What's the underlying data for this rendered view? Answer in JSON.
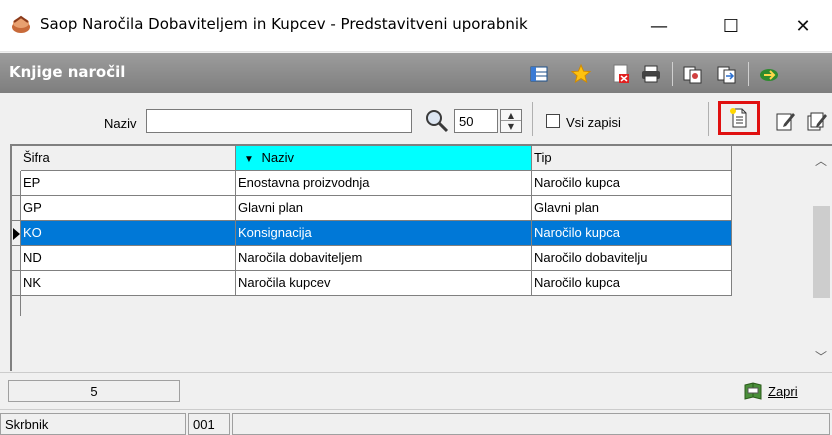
{
  "window": {
    "title": "Saop Naročila Dobaviteljem in Kupcev - Predstavitveni uporabnik",
    "minimize": "—",
    "maximize": "☐",
    "close": "✕"
  },
  "header": {
    "title": "Knjige naročil"
  },
  "toolbar": {
    "naziv_label": "Naziv",
    "naziv_value": "",
    "count_value": "50",
    "vsi_zapisi_label": "Vsi zapisi",
    "vsi_zapisi_checked": false
  },
  "grid": {
    "columns": [
      "Šifra",
      "Naziv",
      "Tip"
    ],
    "sorted_column": "Naziv",
    "rows": [
      {
        "sifra": "EP",
        "naziv": "Enostavna proizvodnja",
        "tip": "Naročilo kupca",
        "selected": false
      },
      {
        "sifra": "GP",
        "naziv": "Glavni plan",
        "tip": "Glavni plan",
        "selected": false
      },
      {
        "sifra": "KO",
        "naziv": "Konsignacija",
        "tip": "Naročilo kupca",
        "selected": true
      },
      {
        "sifra": "ND",
        "naziv": "Naročila dobaviteljem",
        "tip": "Naročilo dobavitelju",
        "selected": false
      },
      {
        "sifra": "NK",
        "naziv": "Naročila kupcev",
        "tip": "Naročilo kupca",
        "selected": false
      }
    ]
  },
  "footer": {
    "record_count": "5",
    "close_label": "Zapri"
  },
  "status": {
    "label": "Skrbnik",
    "code": "001",
    "extra": ""
  },
  "colors": {
    "selected_row": "#0078d7",
    "sorted_header": "#00ffff",
    "header_bar": "#8a8a8a",
    "highlight_border": "#e01010"
  }
}
